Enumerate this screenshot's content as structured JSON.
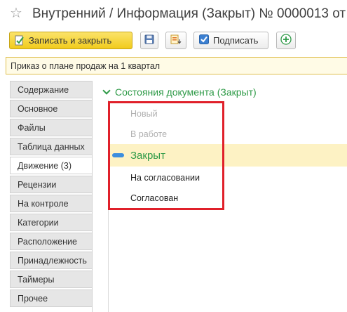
{
  "window": {
    "title": "Внутренний / Информация (Закрыт) № 0000013 от",
    "favorite_icon": "star-icon"
  },
  "toolbar": {
    "save_close_label": "Записать и закрыть",
    "sign_label": "Подписать",
    "icons": [
      "document-check-icon",
      "save-icon",
      "document-create-icon",
      "sign-checkbox-icon",
      "add-icon"
    ]
  },
  "subject": {
    "value": "Приказ о плане продаж на 1 квартал"
  },
  "tabs": [
    {
      "label": "Содержание"
    },
    {
      "label": "Основное"
    },
    {
      "label": "Файлы"
    },
    {
      "label": "Таблица данных"
    },
    {
      "label": "Движение (3)",
      "active": true
    },
    {
      "label": "Рецензии"
    },
    {
      "label": "На контроле"
    },
    {
      "label": "Категории"
    },
    {
      "label": "Расположение"
    },
    {
      "label": "Принадлежность"
    },
    {
      "label": "Таймеры"
    },
    {
      "label": "Прочее"
    }
  ],
  "states_group": {
    "title": "Состояния документа (Закрыт)",
    "items": {
      "new": "Новый",
      "in_work": "В работе",
      "closed": "Закрыт",
      "on_approval": "На согласовании",
      "approved": "Согласован"
    }
  },
  "colors": {
    "accent_green": "#2e9a47",
    "highlight_red": "#e0202a",
    "current_row": "#fdf2c4",
    "primary_button": "#f1cb1c"
  }
}
